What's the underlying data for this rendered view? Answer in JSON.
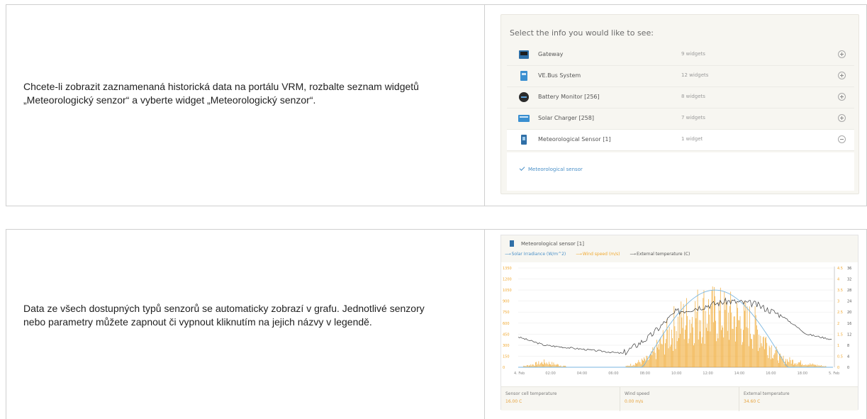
{
  "rows": [
    {
      "description": "Chcete-li zobrazit zaznamenaná historická data na portálu VRM, rozbalte seznam widgetů „Meteorologický senzor“ a vyberte widget „Meteorologický senzor“."
    },
    {
      "description": "Data ze všech dostupných typů senzorů se automaticky zobrazí v grafu. Jednotlivé senzory nebo parametry můžete zapnout či vypnout kliknutím na jejich názvy v legendě."
    }
  ],
  "widget_selector": {
    "title": "Select the info you would like to see:",
    "items": [
      {
        "name": "Gateway",
        "count": "9 widgets",
        "icon": "gateway-device-icon",
        "expanded": false
      },
      {
        "name": "VE.Bus System",
        "count": "12 widgets",
        "icon": "inverter-device-icon",
        "expanded": false
      },
      {
        "name": "Battery Monitor [256]",
        "count": "8 widgets",
        "icon": "battery-monitor-icon",
        "expanded": false
      },
      {
        "name": "Solar Charger [258]",
        "count": "7 widgets",
        "icon": "solar-charger-icon",
        "expanded": false
      },
      {
        "name": "Meteorological Sensor [1]",
        "count": "1 widget",
        "icon": "meteo-sensor-icon",
        "expanded": true
      }
    ],
    "sub_item": "Meteorological sensor"
  },
  "chart_widget": {
    "title": "Meteorological sensor [1]",
    "stats": [
      {
        "label": "Sensor cell temperature",
        "value": "16.00 C"
      },
      {
        "label": "Wind speed",
        "value": "0.00 m/s"
      },
      {
        "label": "External temperature",
        "value": "34.60 C"
      }
    ]
  },
  "chart_data": {
    "type": "line",
    "x_ticks": [
      "4. Feb",
      "02:00",
      "04:00",
      "06:00",
      "08:00",
      "10:00",
      "12:00",
      "14:00",
      "16:00",
      "18:00",
      "5. Feb"
    ],
    "y_left_ticks": [
      "1350",
      "1200",
      "1050",
      "900",
      "750",
      "600",
      "450",
      "300",
      "150",
      "0"
    ],
    "y_mid_ticks": [
      "4.5",
      "4",
      "3.5",
      "3",
      "2.5",
      "2",
      "1.5",
      "1",
      "0.5",
      "0"
    ],
    "y_right_ticks": [
      "36",
      "32",
      "28",
      "24",
      "20",
      "16",
      "12",
      "8",
      "4",
      "0"
    ],
    "series": [
      {
        "name": "Solar Irradiance (W/m^2)",
        "color": "#7ab6e0",
        "x": [
          0,
          10,
          14,
          16,
          18,
          19,
          21,
          24
        ],
        "values": [
          0,
          0,
          800,
          1050,
          900,
          500,
          0,
          0
        ]
      },
      {
        "name": "Wind speed (m/s)",
        "color": "#f0a830",
        "x": [
          0,
          2,
          4,
          6,
          8,
          10,
          12,
          14,
          16,
          18,
          20,
          22,
          24
        ],
        "values": [
          0,
          0.3,
          0,
          0,
          0,
          0.5,
          2.5,
          3.3,
          3.0,
          2.4,
          0.5,
          0.2,
          0
        ]
      },
      {
        "name": "External temperature (C)",
        "color": "#3c3c3c",
        "x": [
          0,
          2,
          4,
          6,
          8,
          10,
          12,
          14,
          16,
          18,
          20,
          22,
          24
        ],
        "values": [
          11,
          8,
          7,
          6,
          5,
          11,
          20,
          22,
          24,
          23,
          19,
          12,
          10
        ]
      }
    ]
  }
}
